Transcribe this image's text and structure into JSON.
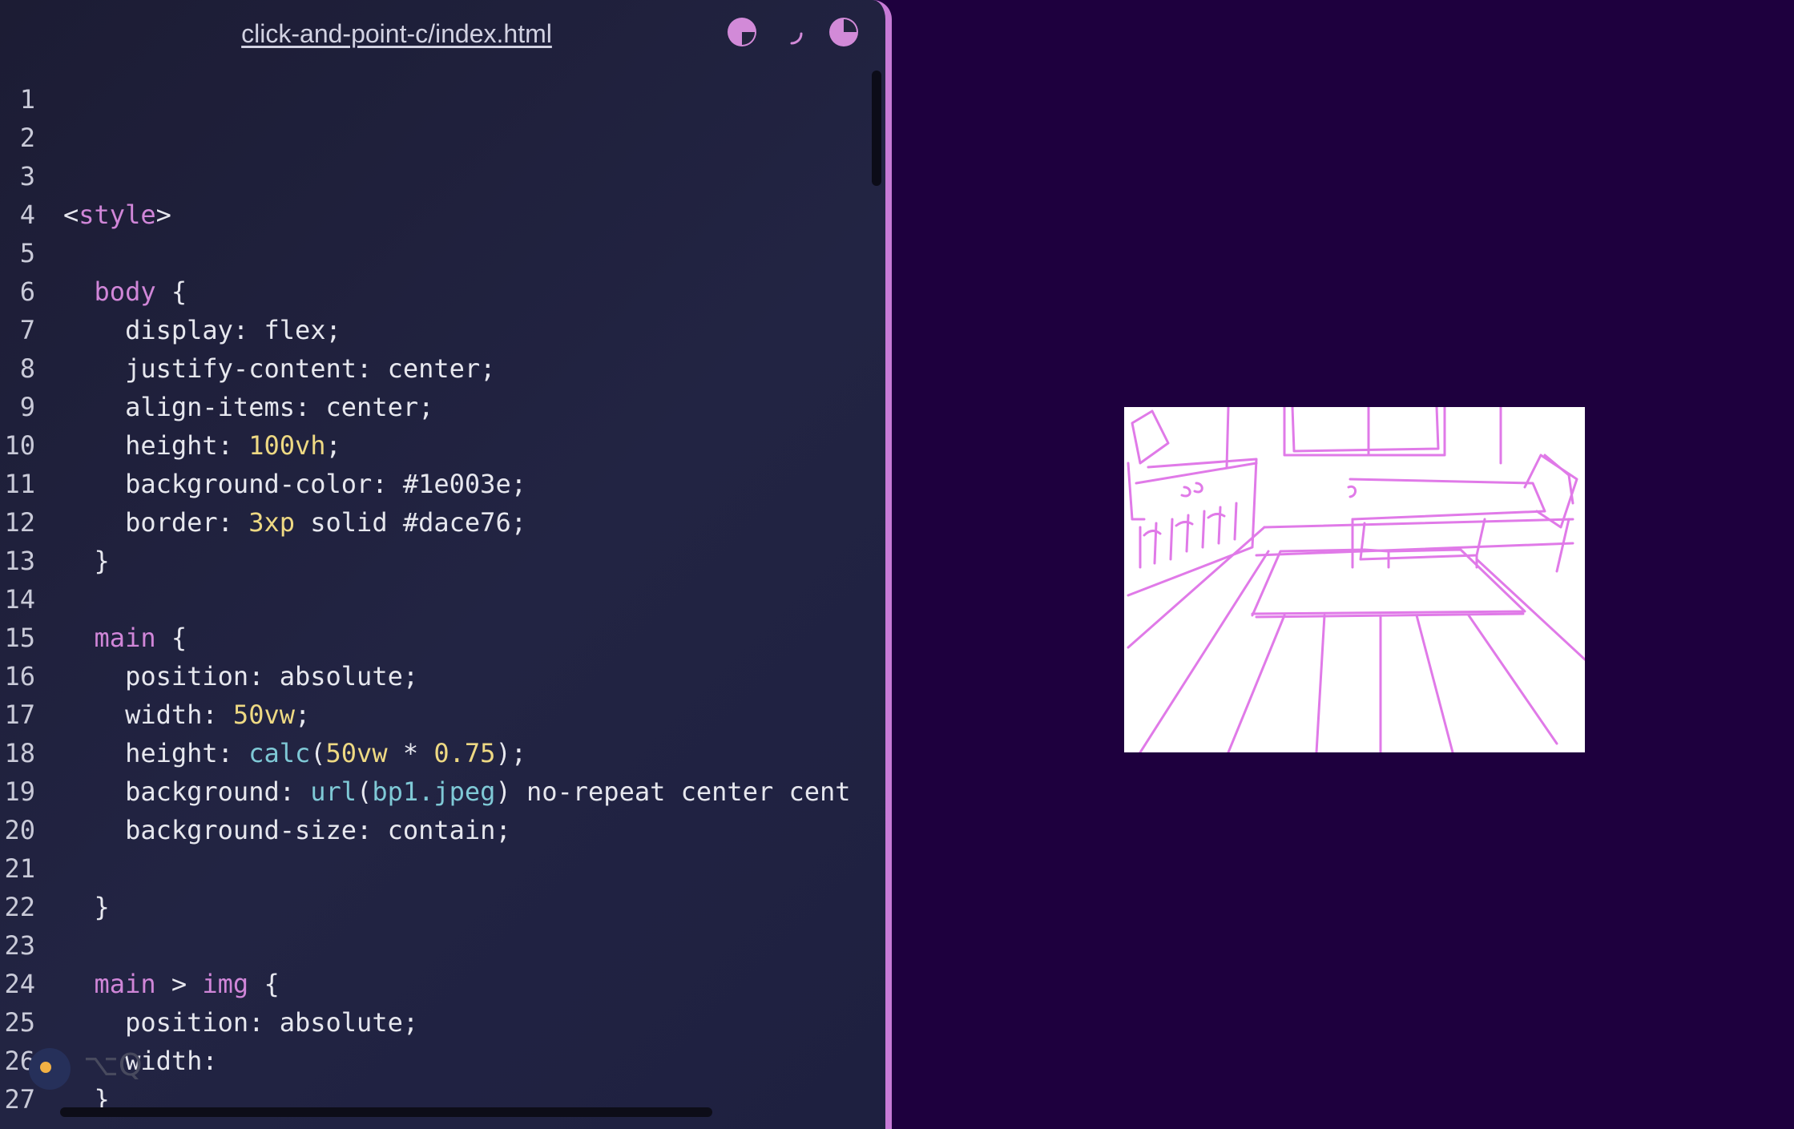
{
  "editor": {
    "file_title": "click-and-point-c/index.html",
    "buttons": [
      {
        "name": "theme-toggle-icon"
      },
      {
        "name": "loading-spinner-icon"
      },
      {
        "name": "preview-toggle-icon"
      }
    ],
    "hint": {
      "shortcut": "⌥Q"
    },
    "colors": {
      "accent": "#c77ad6",
      "tag": "#d086d8",
      "number": "#eed983",
      "function": "#7fc9d6",
      "text": "#e6e7ee"
    },
    "lines": [
      {
        "n": "1",
        "t": []
      },
      {
        "n": "2",
        "t": []
      },
      {
        "n": "3",
        "t": []
      },
      {
        "n": "4",
        "t": [
          {
            "c": "txt",
            "v": "<"
          },
          {
            "c": "tag",
            "v": "style"
          },
          {
            "c": "txt",
            "v": ">"
          }
        ]
      },
      {
        "n": "5",
        "t": []
      },
      {
        "n": "6",
        "t": [
          {
            "c": "txt",
            "v": "  "
          },
          {
            "c": "sel",
            "v": "body"
          },
          {
            "c": "txt",
            "v": " {"
          }
        ]
      },
      {
        "n": "7",
        "t": [
          {
            "c": "txt",
            "v": "    display: flex;"
          }
        ]
      },
      {
        "n": "8",
        "t": [
          {
            "c": "txt",
            "v": "    justify-content: center;"
          }
        ]
      },
      {
        "n": "9",
        "t": [
          {
            "c": "txt",
            "v": "    align-items: center;"
          }
        ]
      },
      {
        "n": "10",
        "t": [
          {
            "c": "txt",
            "v": "    height: "
          },
          {
            "c": "num",
            "v": "100vh"
          },
          {
            "c": "txt",
            "v": ";"
          }
        ]
      },
      {
        "n": "11",
        "t": [
          {
            "c": "txt",
            "v": "    background-color: #1e003e;"
          }
        ]
      },
      {
        "n": "12",
        "t": [
          {
            "c": "txt",
            "v": "    border: "
          },
          {
            "c": "num",
            "v": "3xp"
          },
          {
            "c": "txt",
            "v": " solid #dace76;"
          }
        ]
      },
      {
        "n": "13",
        "t": [
          {
            "c": "txt",
            "v": "  }"
          }
        ]
      },
      {
        "n": "14",
        "t": []
      },
      {
        "n": "15",
        "t": [
          {
            "c": "txt",
            "v": "  "
          },
          {
            "c": "sel",
            "v": "main"
          },
          {
            "c": "txt",
            "v": " {"
          }
        ]
      },
      {
        "n": "16",
        "t": [
          {
            "c": "txt",
            "v": "    position: absolute;"
          }
        ]
      },
      {
        "n": "17",
        "t": [
          {
            "c": "txt",
            "v": "    width: "
          },
          {
            "c": "num",
            "v": "50vw"
          },
          {
            "c": "txt",
            "v": ";"
          }
        ]
      },
      {
        "n": "18",
        "t": [
          {
            "c": "txt",
            "v": "    height: "
          },
          {
            "c": "fn",
            "v": "calc"
          },
          {
            "c": "txt",
            "v": "("
          },
          {
            "c": "num",
            "v": "50vw"
          },
          {
            "c": "txt",
            "v": " * "
          },
          {
            "c": "num",
            "v": "0.75"
          },
          {
            "c": "txt",
            "v": ");"
          }
        ]
      },
      {
        "n": "19",
        "t": [
          {
            "c": "txt",
            "v": "    background: "
          },
          {
            "c": "fn",
            "v": "url"
          },
          {
            "c": "txt",
            "v": "("
          },
          {
            "c": "fn",
            "v": "bp1.jpeg"
          },
          {
            "c": "txt",
            "v": ") no-repeat center cent"
          }
        ]
      },
      {
        "n": "20",
        "t": [
          {
            "c": "txt",
            "v": "    background-size: contain;"
          }
        ]
      },
      {
        "n": "21",
        "t": []
      },
      {
        "n": "22",
        "t": [
          {
            "c": "txt",
            "v": "  }"
          }
        ]
      },
      {
        "n": "23",
        "t": []
      },
      {
        "n": "24",
        "t": [
          {
            "c": "txt",
            "v": "  "
          },
          {
            "c": "sel",
            "v": "main"
          },
          {
            "c": "txt",
            "v": " > "
          },
          {
            "c": "sel",
            "v": "img"
          },
          {
            "c": "txt",
            "v": " {"
          }
        ]
      },
      {
        "n": "25",
        "t": [
          {
            "c": "txt",
            "v": "    position: absolute;"
          }
        ]
      },
      {
        "n": "26",
        "t": [
          {
            "c": "txt",
            "v": "    width:"
          }
        ]
      },
      {
        "n": "27",
        "t": [
          {
            "c": "txt",
            "v": "  }"
          }
        ]
      }
    ]
  },
  "preview": {
    "background": "#1e003e",
    "sketch": {
      "stroke_color": "#e07ae8",
      "subject": "room-sketch"
    }
  }
}
